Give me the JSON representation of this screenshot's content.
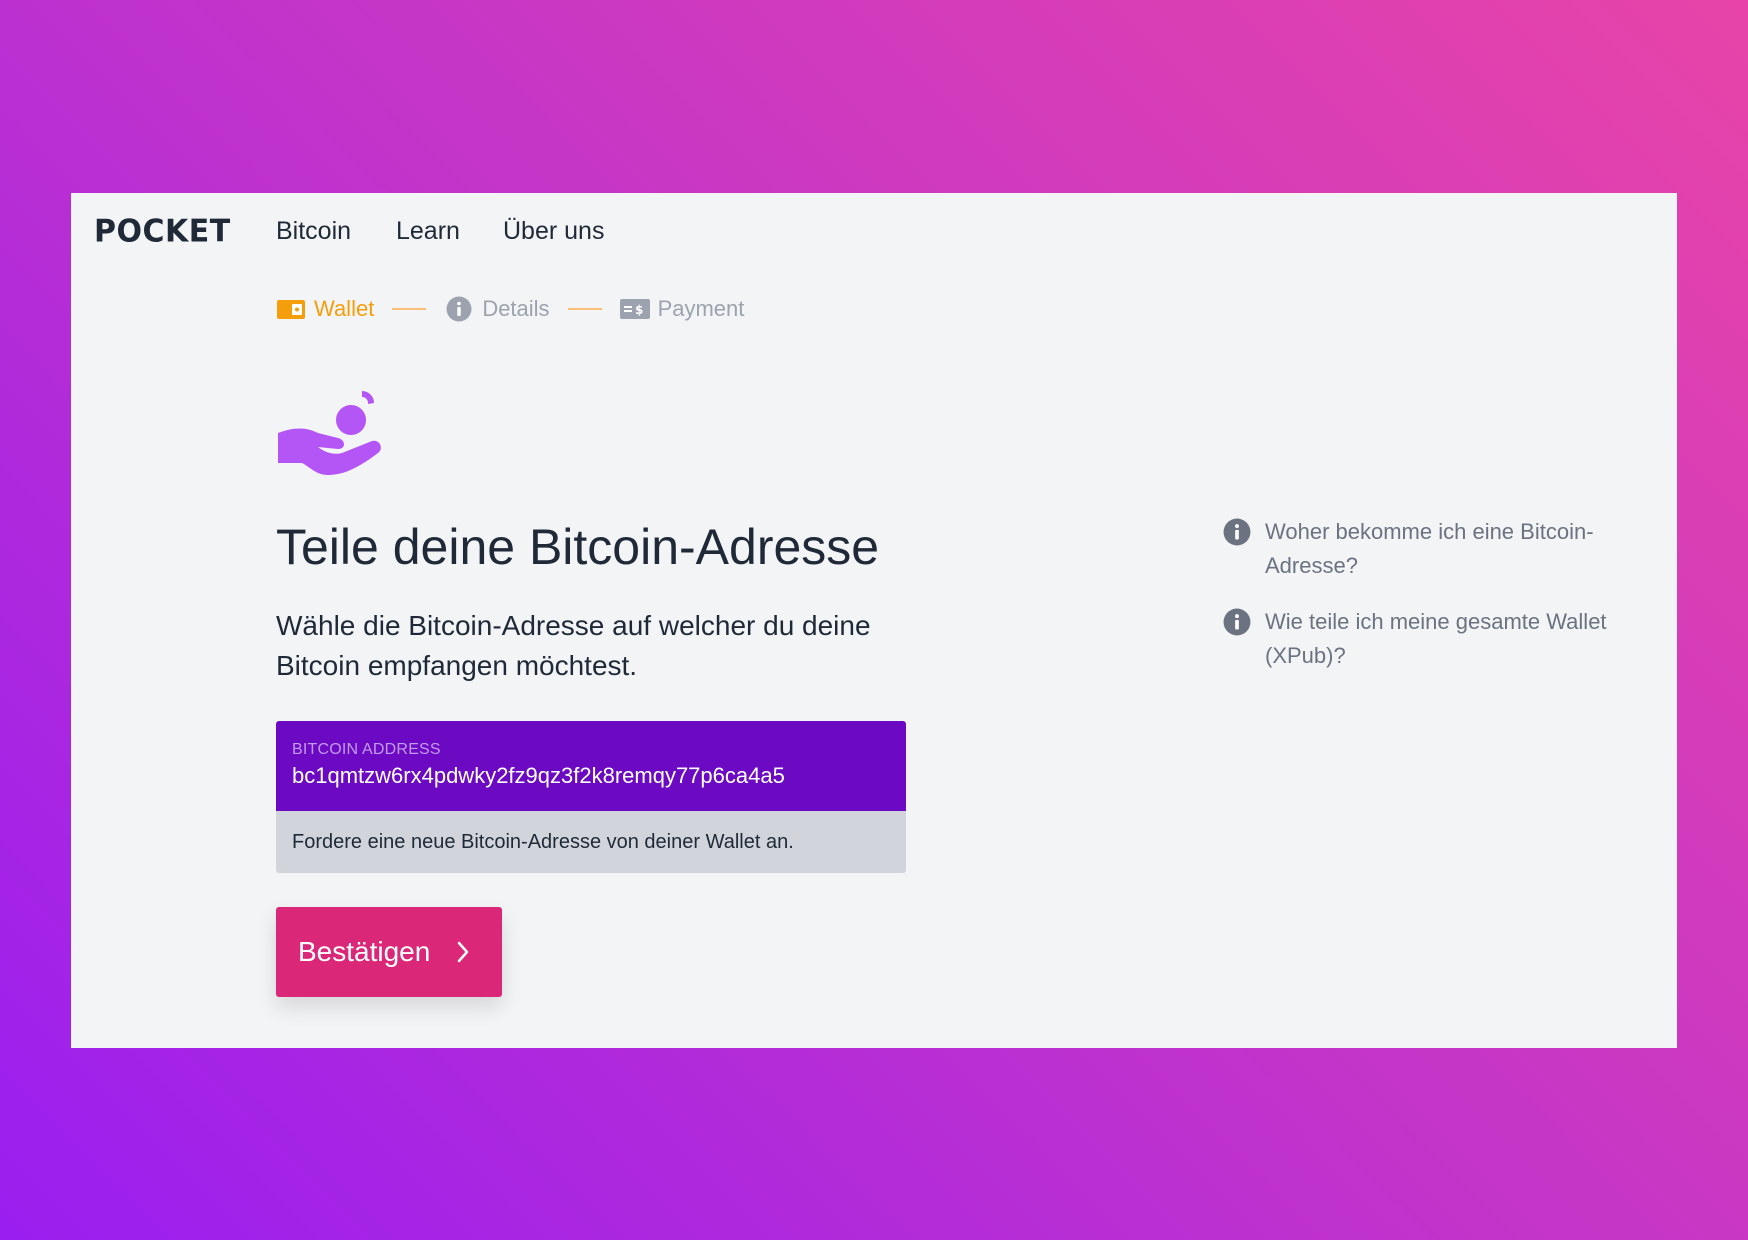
{
  "brand": {
    "logo": "POCKET"
  },
  "nav": {
    "items": [
      "Bitcoin",
      "Learn",
      "Über uns"
    ]
  },
  "steps": [
    {
      "label": "Wallet",
      "icon": "wallet-icon",
      "state": "active"
    },
    {
      "label": "Details",
      "icon": "info-icon",
      "state": "inactive"
    },
    {
      "label": "Payment",
      "icon": "payment-icon",
      "state": "inactive"
    }
  ],
  "main": {
    "title": "Teile deine Bitcoin-Adresse",
    "subtitle": "Wähle die Bitcoin-Adresse auf welcher du deine Bitcoin empfangen möchtest.",
    "address": {
      "label": "BITCOIN ADDRESS",
      "value": "bc1qmtzw6rx4pdwky2fz9qz3f2k8remqy77p6ca4a5",
      "hint": "Fordere eine neue Bitcoin-Adresse von deiner Wallet an."
    },
    "confirm_label": "Bestätigen"
  },
  "help": {
    "items": [
      "Woher bekomme ich eine Bitcoin-Adresse?",
      "Wie teile ich meine gesamte Wallet (XPub)?"
    ]
  },
  "colors": {
    "accent_orange": "#f59e0b",
    "address_card_bg": "#6b0ac2",
    "confirm_button": "#db2777",
    "hand_icon": "#b455f5"
  }
}
